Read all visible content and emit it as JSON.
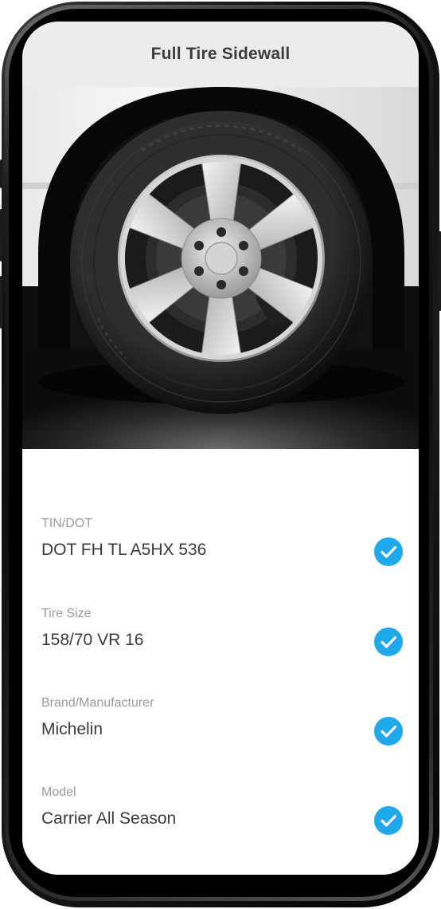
{
  "header": {
    "title": "Full Tire Sidewall"
  },
  "photo": {
    "subject": "tire-wheel-photo"
  },
  "fields": [
    {
      "label": "TIN/DOT",
      "value": "DOT FH TL A5HX 536",
      "status": "verified"
    },
    {
      "label": "Tire Size",
      "value": "158/70 VR 16",
      "status": "verified"
    },
    {
      "label": "Brand/Manufacturer",
      "value": "Michelin",
      "status": "verified"
    },
    {
      "label": "Model",
      "value": "Carrier All Season",
      "status": "verified"
    }
  ],
  "colors": {
    "header_bg": "#ececec",
    "check_blue": "#1fa9ea",
    "label_gray": "#9a9a9a",
    "value_dark": "#3a3a3a"
  }
}
